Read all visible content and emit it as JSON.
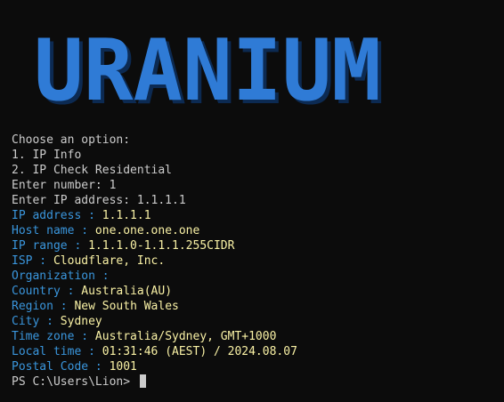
{
  "banner": {
    "text": "URANIUM"
  },
  "colors": {
    "background": "#0c0c0c",
    "default_text": "#cccccc",
    "label_blue": "#3a96dd",
    "value_yellow": "#f9f1a5",
    "banner_blue": "#2f7bd6"
  },
  "menu": {
    "prompt": "Choose an option:",
    "option1": "1. IP Info",
    "option2": "2. IP Check Residential",
    "enter_number": "Enter number: 1",
    "enter_ip": "Enter IP address: 1.1.1.1"
  },
  "results": [
    {
      "label": "IP address : ",
      "value": "1.1.1.1"
    },
    {
      "label": "Host name : ",
      "value": "one.one.one.one"
    },
    {
      "label": "IP range : ",
      "value": "1.1.1.0-1.1.1.255CIDR"
    },
    {
      "label": "ISP : ",
      "value": "Cloudflare, Inc."
    },
    {
      "label": "Organization : ",
      "value": ""
    },
    {
      "label": "Country : ",
      "value": "Australia(AU)"
    },
    {
      "label": "Region : ",
      "value": "New South Wales"
    },
    {
      "label": "City : ",
      "value": "Sydney"
    },
    {
      "label": "Time zone : ",
      "value": "Australia/Sydney, GMT+1000"
    },
    {
      "label": "Local time : ",
      "value": "01:31:46 (AEST) / 2024.08.07"
    },
    {
      "label": "Postal Code : ",
      "value": "1001"
    }
  ],
  "prompt": {
    "text": "PS C:\\Users\\Lion> "
  }
}
